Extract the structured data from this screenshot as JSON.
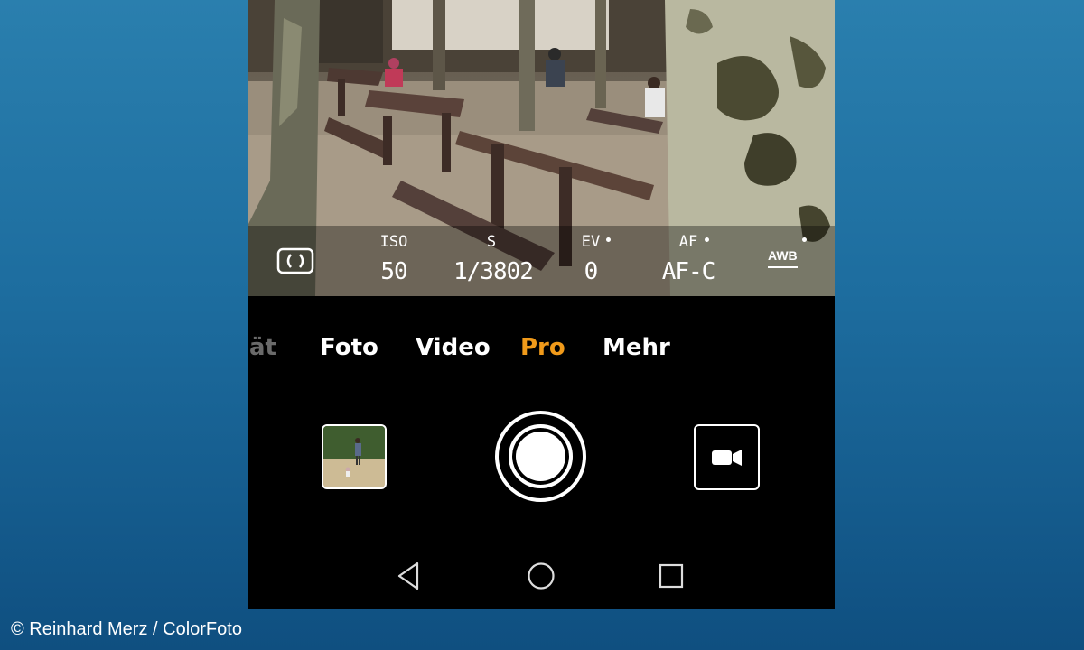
{
  "pro_params": {
    "metering_icon": "metering-mode-icon",
    "iso": {
      "label": "ISO",
      "value": "50"
    },
    "shutter": {
      "label": "S",
      "value": "1/3802"
    },
    "ev": {
      "label": "EV",
      "value": "0"
    },
    "af": {
      "label": "AF",
      "value": "AF-C"
    },
    "wb": {
      "label": "AWB"
    }
  },
  "modes": {
    "partial": "ät",
    "items": [
      "Foto",
      "Video",
      "Pro",
      "Mehr"
    ],
    "active": "Pro",
    "accent_color": "#f09a1a"
  },
  "controls": {
    "gallery_icon": "gallery-thumbnail",
    "shutter_icon": "shutter-button",
    "video_icon": "video-camera-icon"
  },
  "navbar": {
    "back_icon": "back-triangle-icon",
    "home_icon": "home-circle-icon",
    "recents_icon": "recents-square-icon"
  },
  "credit": "© Reinhard Merz / ColorFoto"
}
